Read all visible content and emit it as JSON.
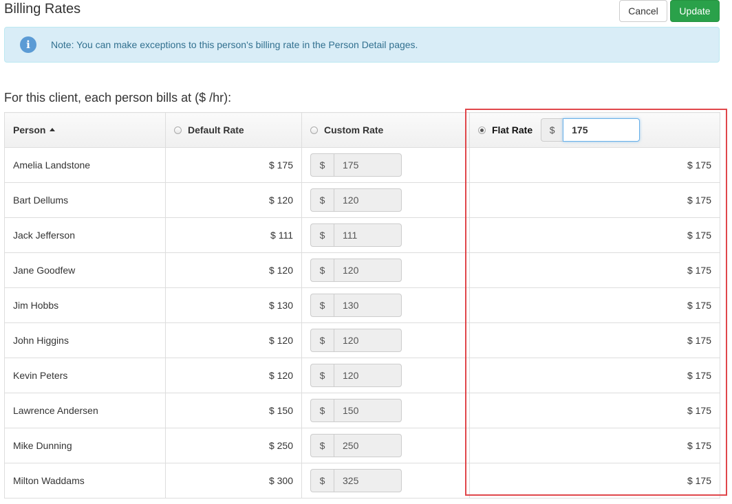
{
  "header": {
    "title": "Billing Rates",
    "cancel_label": "Cancel",
    "update_label": "Update"
  },
  "alert": {
    "icon": "info-icon",
    "text": "Note: You can make exceptions to this person's billing rate in the Person Detail pages."
  },
  "subtitle": "For this client, each person bills at ($ /hr):",
  "table": {
    "headers": {
      "person": "Person",
      "default_rate": "Default Rate",
      "custom_rate": "Custom Rate",
      "flat_rate": "Flat Rate"
    },
    "selected_option": "flat_rate",
    "flat_rate_currency": "$",
    "flat_rate_value": "175",
    "rows": [
      {
        "person": "Amelia Landstone",
        "default": "$ 175",
        "custom_currency": "$",
        "custom": "175",
        "flat": "$ 175"
      },
      {
        "person": "Bart Dellums",
        "default": "$ 120",
        "custom_currency": "$",
        "custom": "120",
        "flat": "$ 175"
      },
      {
        "person": "Jack Jefferson",
        "default": "$ 111",
        "custom_currency": "$",
        "custom": "111",
        "flat": "$ 175"
      },
      {
        "person": "Jane Goodfew",
        "default": "$ 120",
        "custom_currency": "$",
        "custom": "120",
        "flat": "$ 175"
      },
      {
        "person": "Jim Hobbs",
        "default": "$ 130",
        "custom_currency": "$",
        "custom": "130",
        "flat": "$ 175"
      },
      {
        "person": "John Higgins",
        "default": "$ 120",
        "custom_currency": "$",
        "custom": "120",
        "flat": "$ 175"
      },
      {
        "person": "Kevin Peters",
        "default": "$ 120",
        "custom_currency": "$",
        "custom": "120",
        "flat": "$ 175"
      },
      {
        "person": "Lawrence Andersen",
        "default": "$ 150",
        "custom_currency": "$",
        "custom": "150",
        "flat": "$ 175"
      },
      {
        "person": "Mike Dunning",
        "default": "$ 250",
        "custom_currency": "$",
        "custom": "250",
        "flat": "$ 175"
      },
      {
        "person": "Milton Waddams",
        "default": "$ 300",
        "custom_currency": "$",
        "custom": "325",
        "flat": "$ 175"
      }
    ]
  },
  "colors": {
    "update_button": "#2aa14a",
    "alert_bg": "#d9edf7",
    "alert_text": "#31708f",
    "highlight_border": "#e0464a"
  }
}
